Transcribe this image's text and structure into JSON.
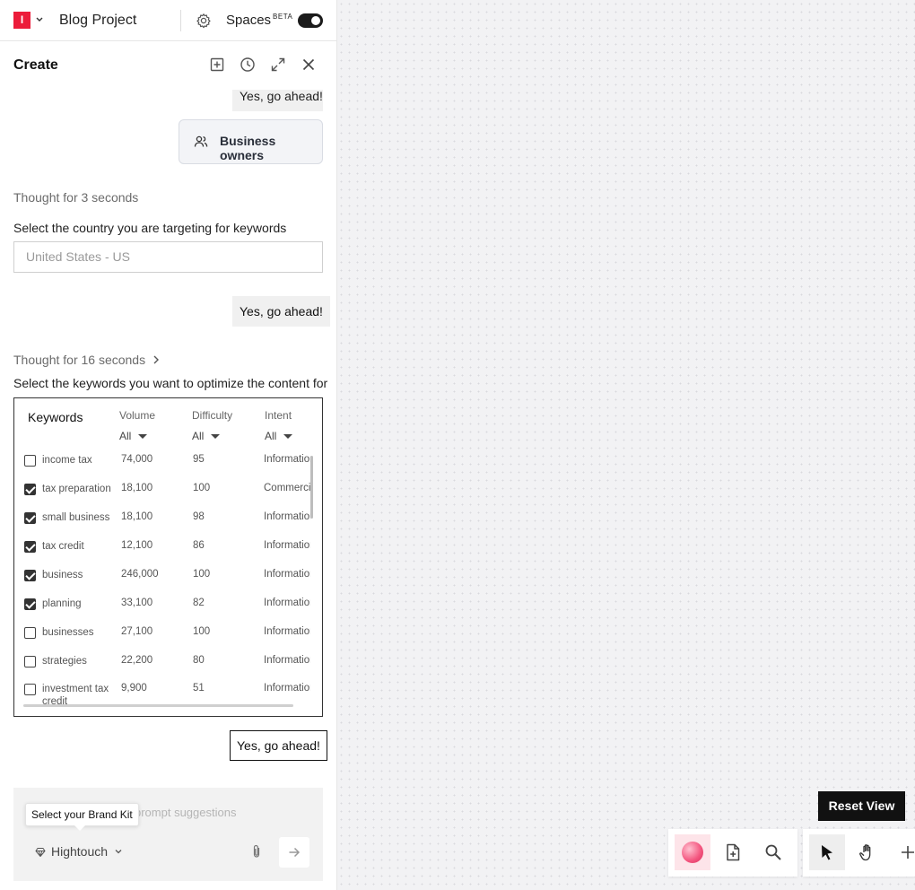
{
  "topbar": {
    "logo_letter": "I",
    "project_name": "Blog Project",
    "spaces_label": "Spaces",
    "spaces_badge": "BETA",
    "spaces_enabled": true
  },
  "header": {
    "title": "Create"
  },
  "chat": {
    "prev_reply": "Yes, go ahead!",
    "audience_chip": "Business owners",
    "thought_1": "Thought for 3 seconds",
    "country_prompt": "Select the country you are targeting for keywords",
    "country_placeholder": "United States - US",
    "reply_2": "Yes, go ahead!",
    "thought_2": "Thought for 16 seconds",
    "keywords_prompt": "Select the keywords you want to optimize the content for",
    "reply_3": "Yes, go ahead!"
  },
  "keywords_table": {
    "columns": {
      "keyword": "Keywords",
      "volume": "Volume",
      "difficulty": "Difficulty",
      "intent": "Intent"
    },
    "filters": {
      "volume": "All",
      "difficulty": "All",
      "intent": "All"
    },
    "rows": [
      {
        "keyword": "income tax",
        "volume": "74,000",
        "difficulty": "95",
        "intent": "Informational",
        "checked": false
      },
      {
        "keyword": "tax preparation",
        "volume": "18,100",
        "difficulty": "100",
        "intent": "Commercial",
        "checked": true
      },
      {
        "keyword": "small business",
        "volume": "18,100",
        "difficulty": "98",
        "intent": "Informational",
        "checked": true
      },
      {
        "keyword": "tax credit",
        "volume": "12,100",
        "difficulty": "86",
        "intent": "Informational",
        "checked": true
      },
      {
        "keyword": "business",
        "volume": "246,000",
        "difficulty": "100",
        "intent": "Informational",
        "checked": true
      },
      {
        "keyword": "planning",
        "volume": "33,100",
        "difficulty": "82",
        "intent": "Informational",
        "checked": true
      },
      {
        "keyword": "businesses",
        "volume": "27,100",
        "difficulty": "100",
        "intent": "Informational",
        "checked": false
      },
      {
        "keyword": "strategies",
        "volume": "22,200",
        "difficulty": "80",
        "intent": "Informational",
        "checked": false
      },
      {
        "keyword": "investment tax credit",
        "volume": "9,900",
        "difficulty": "51",
        "intent": "Informational",
        "checked": false
      }
    ]
  },
  "composer": {
    "placeholder_visible": "prompt suggestions",
    "tooltip": "Select your Brand Kit",
    "brand_kit": "Hightouch"
  },
  "canvas": {
    "reset_view": "Reset View"
  },
  "icons": {
    "gear": "gear-icon",
    "add_frame": "add-frame-icon",
    "history": "clock-icon",
    "expand": "expand-icon",
    "close": "close-icon",
    "users": "users-icon",
    "attach": "paperclip-icon",
    "send": "arrow-right-icon",
    "new_page": "file-plus-icon",
    "search": "search-icon",
    "pointer": "pointer-icon",
    "hand": "hand-icon",
    "add": "plus-icon"
  },
  "colors": {
    "brand": "#ec1c3a",
    "accent_pink": "#f3547e",
    "dark": "#111111"
  }
}
